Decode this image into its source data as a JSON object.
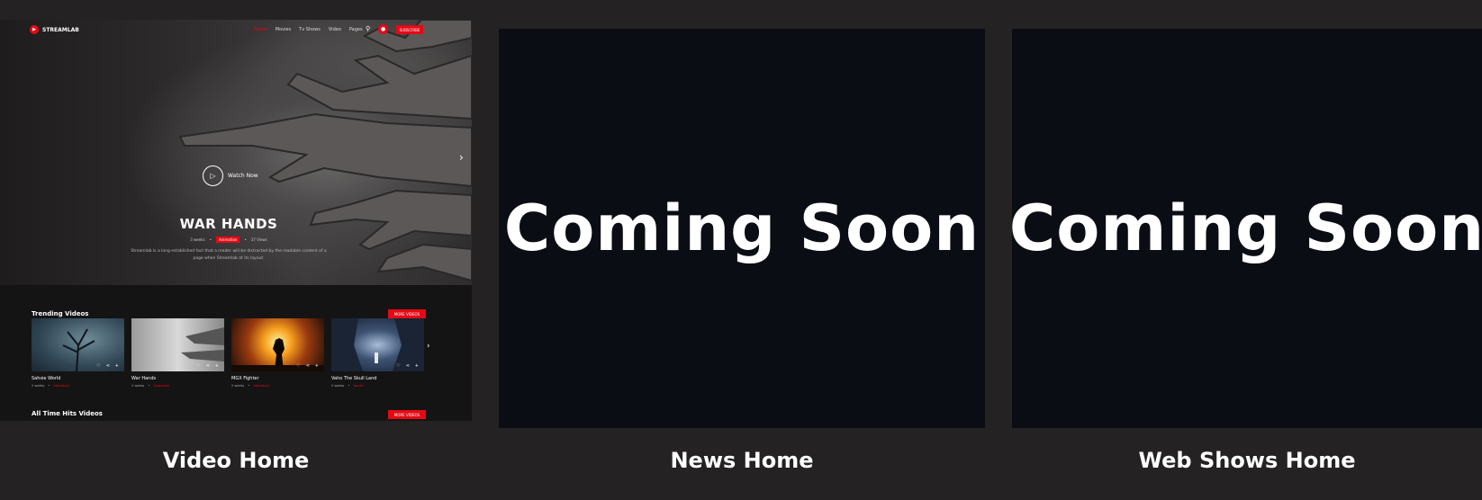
{
  "cards": [
    {
      "label": "Video Home",
      "nav": {
        "logo": "STREAMLAB",
        "menu": [
          "Home",
          "Movies",
          "Tv Shows",
          "Video",
          "Pages"
        ],
        "subscribe": "SUBSCRIBE"
      },
      "hero": {
        "watch_now": "Watch Now",
        "title": "WAR HANDS",
        "meta_age": "3 weeks",
        "meta_genre": "Animation",
        "meta_views": "37 Views",
        "description": "Streamlab is a long established fact that a reader will be distracted by the readable content of a page when Streamlab at its layout."
      },
      "trending": {
        "title": "Trending Videos",
        "more": "MORE VIDEOS",
        "items": [
          {
            "title": "Sahsie World",
            "age": "2 weeks",
            "genre": "Adventure"
          },
          {
            "title": "War Hands",
            "age": "2 weeks",
            "genre": "Animation"
          },
          {
            "title": "MGX Fighter",
            "age": "2 weeks",
            "genre": "Adventure"
          },
          {
            "title": "Vaho The Skull Land",
            "age": "2 weeks",
            "genre": "Horror"
          }
        ]
      },
      "all_time": {
        "title": "All Time Hits Videos",
        "more": "MORE VIDEOS"
      }
    },
    {
      "label": "News Home",
      "placeholder": "Coming Soon"
    },
    {
      "label": "Web Shows Home",
      "placeholder": "Coming Soon"
    }
  ],
  "colors": {
    "accent": "#e50914",
    "page_bg": "#242222",
    "placeholder_bg": "#0a0d14"
  }
}
